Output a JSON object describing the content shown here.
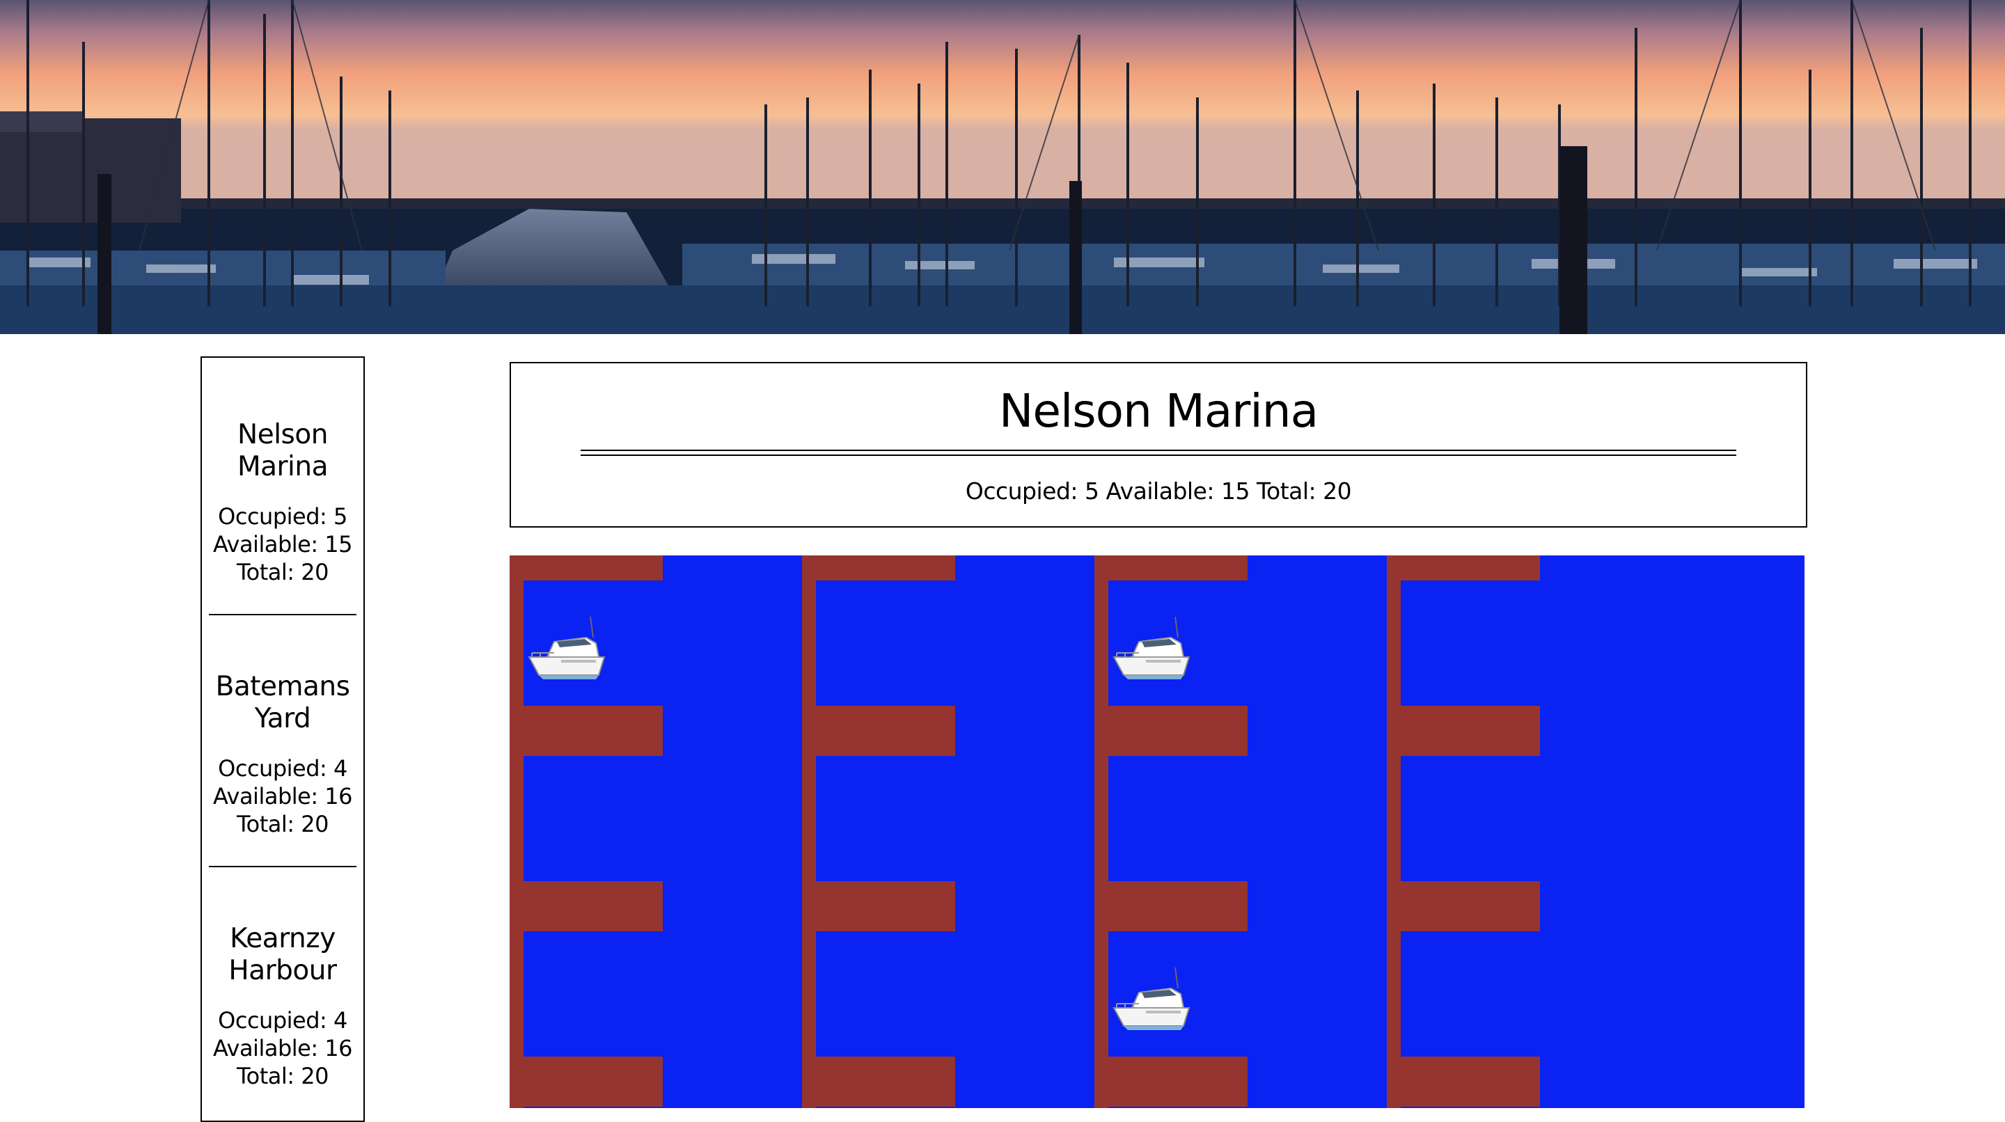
{
  "banner": {
    "image": "marina-sunset-photo"
  },
  "sidebar": {
    "marinas": [
      {
        "name_line1": "Nelson",
        "name_line2": "Marina",
        "occupied": "Occupied: 5",
        "available": "Available: 15",
        "total": "Total: 20"
      },
      {
        "name_line1": "Batemans",
        "name_line2": "Yard",
        "occupied": "Occupied: 4",
        "available": "Available: 16",
        "total": "Total: 20"
      },
      {
        "name_line1": "Kearnzy",
        "name_line2": "Harbour",
        "occupied": "Occupied: 4",
        "available": "Available: 16",
        "total": "Total: 20"
      }
    ]
  },
  "header": {
    "title": "Nelson Marina",
    "occupied": "Occupied: 5",
    "available": "Available: 15",
    "total": "Total: 20"
  },
  "map": {
    "water_color": "#0a22f2",
    "dock_color": "#963530",
    "docks": [
      {
        "berths": [
          "occupied",
          "empty",
          "empty"
        ]
      },
      {
        "berths": [
          "empty",
          "empty",
          "empty"
        ]
      },
      {
        "berths": [
          "occupied",
          "empty",
          "occupied"
        ]
      },
      {
        "berths": [
          "empty",
          "empty",
          "empty"
        ]
      }
    ],
    "boat_icon": "motor-yacht-icon"
  }
}
